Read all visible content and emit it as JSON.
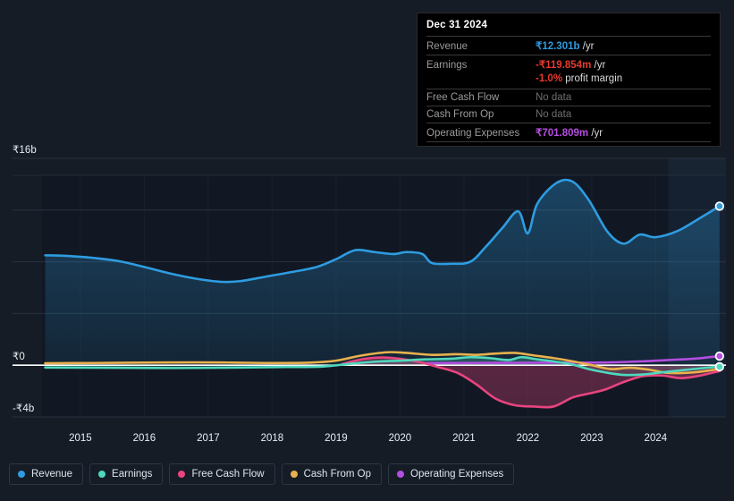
{
  "chart_data": {
    "type": "area",
    "title": "",
    "xlabel": "",
    "ylabel": "",
    "currency": "₹",
    "ylim": [
      -4,
      16
    ],
    "y_ticks": [
      {
        "label": "₹16b",
        "value": 16
      },
      {
        "label": "₹0",
        "value": 0
      },
      {
        "label": "-₹4b",
        "value": -4
      }
    ],
    "gridlines": [
      16,
      12,
      8,
      4,
      0,
      -4
    ],
    "x_ticks": [
      "2015",
      "2016",
      "2017",
      "2018",
      "2019",
      "2020",
      "2021",
      "2022",
      "2023",
      "2024"
    ],
    "xlim": [
      "2014.4",
      "2025.1"
    ],
    "grid": true,
    "legend_position": "bottom",
    "forecast_band_start": "2024.2",
    "series": [
      {
        "name": "Revenue",
        "color": "#2e9ce0",
        "fill": true,
        "end_value": 12.301,
        "points": [
          [
            2014.45,
            8.5
          ],
          [
            2014.8,
            8.45
          ],
          [
            2015.2,
            8.3
          ],
          [
            2015.6,
            8.05
          ],
          [
            2016.0,
            7.6
          ],
          [
            2016.4,
            7.1
          ],
          [
            2016.8,
            6.7
          ],
          [
            2017.2,
            6.45
          ],
          [
            2017.5,
            6.5
          ],
          [
            2017.9,
            6.85
          ],
          [
            2018.3,
            7.2
          ],
          [
            2018.7,
            7.6
          ],
          [
            2019.0,
            8.2
          ],
          [
            2019.3,
            8.9
          ],
          [
            2019.6,
            8.75
          ],
          [
            2019.9,
            8.6
          ],
          [
            2020.1,
            8.75
          ],
          [
            2020.35,
            8.6
          ],
          [
            2020.5,
            7.9
          ],
          [
            2020.8,
            7.85
          ],
          [
            2021.1,
            8.0
          ],
          [
            2021.35,
            9.2
          ],
          [
            2021.6,
            10.6
          ],
          [
            2021.85,
            11.9
          ],
          [
            2022.0,
            10.2
          ],
          [
            2022.15,
            12.5
          ],
          [
            2022.45,
            14.1
          ],
          [
            2022.7,
            14.2
          ],
          [
            2022.95,
            12.8
          ],
          [
            2023.25,
            10.3
          ],
          [
            2023.5,
            9.4
          ],
          [
            2023.75,
            10.1
          ],
          [
            2024.0,
            9.9
          ],
          [
            2024.35,
            10.4
          ],
          [
            2024.7,
            11.4
          ],
          [
            2025.0,
            12.301
          ]
        ]
      },
      {
        "name": "Earnings",
        "color": "#4fd8bd",
        "fill": true,
        "end_value": -0.119854,
        "points": [
          [
            2014.45,
            -0.18
          ],
          [
            2015.5,
            -0.2
          ],
          [
            2016.5,
            -0.22
          ],
          [
            2017.5,
            -0.18
          ],
          [
            2018.2,
            -0.14
          ],
          [
            2018.8,
            -0.1
          ],
          [
            2019.3,
            0.15
          ],
          [
            2019.7,
            0.3
          ],
          [
            2020.0,
            0.35
          ],
          [
            2020.4,
            0.45
          ],
          [
            2020.8,
            0.5
          ],
          [
            2021.1,
            0.62
          ],
          [
            2021.4,
            0.55
          ],
          [
            2021.7,
            0.4
          ],
          [
            2021.9,
            0.62
          ],
          [
            2022.15,
            0.45
          ],
          [
            2022.4,
            0.3
          ],
          [
            2022.7,
            0.05
          ],
          [
            2022.95,
            -0.3
          ],
          [
            2023.2,
            -0.55
          ],
          [
            2023.5,
            -0.75
          ],
          [
            2023.8,
            -0.72
          ],
          [
            2024.1,
            -0.55
          ],
          [
            2024.5,
            -0.35
          ],
          [
            2024.8,
            -0.2
          ],
          [
            2025.0,
            -0.119854
          ]
        ]
      },
      {
        "name": "Free Cash Flow",
        "color": "#e8447f",
        "fill": true,
        "end_value": null,
        "points": [
          [
            2019.1,
            0.1
          ],
          [
            2019.4,
            0.45
          ],
          [
            2019.7,
            0.6
          ],
          [
            2020.0,
            0.5
          ],
          [
            2020.3,
            0.25
          ],
          [
            2020.6,
            -0.15
          ],
          [
            2020.9,
            -0.6
          ],
          [
            2021.2,
            -1.5
          ],
          [
            2021.5,
            -2.6
          ],
          [
            2021.8,
            -3.1
          ],
          [
            2022.1,
            -3.2
          ],
          [
            2022.4,
            -3.2
          ],
          [
            2022.7,
            -2.5
          ],
          [
            2022.95,
            -2.2
          ],
          [
            2023.2,
            -1.9
          ],
          [
            2023.5,
            -1.3
          ],
          [
            2023.8,
            -0.85
          ],
          [
            2024.1,
            -0.8
          ],
          [
            2024.4,
            -1.0
          ],
          [
            2024.7,
            -0.8
          ],
          [
            2025.0,
            -0.45
          ]
        ]
      },
      {
        "name": "Cash From Op",
        "color": "#e8b14c",
        "fill": false,
        "end_value": null,
        "points": [
          [
            2014.45,
            0.15
          ],
          [
            2015.2,
            0.17
          ],
          [
            2016.0,
            0.2
          ],
          [
            2016.8,
            0.22
          ],
          [
            2017.4,
            0.2
          ],
          [
            2018.0,
            0.17
          ],
          [
            2018.6,
            0.2
          ],
          [
            2019.0,
            0.35
          ],
          [
            2019.4,
            0.75
          ],
          [
            2019.8,
            1.0
          ],
          [
            2020.1,
            0.95
          ],
          [
            2020.5,
            0.8
          ],
          [
            2020.9,
            0.85
          ],
          [
            2021.2,
            0.8
          ],
          [
            2021.5,
            0.9
          ],
          [
            2021.8,
            0.95
          ],
          [
            2022.1,
            0.75
          ],
          [
            2022.4,
            0.55
          ],
          [
            2022.7,
            0.3
          ],
          [
            2023.0,
            0.0
          ],
          [
            2023.3,
            -0.3
          ],
          [
            2023.6,
            -0.2
          ],
          [
            2023.9,
            -0.35
          ],
          [
            2024.2,
            -0.6
          ],
          [
            2024.6,
            -0.55
          ],
          [
            2025.0,
            -0.3
          ]
        ]
      },
      {
        "name": "Operating Expenses",
        "color": "#b44ee0",
        "fill": false,
        "end_value": 0.701809,
        "points": [
          [
            2020.4,
            0.16
          ],
          [
            2021.0,
            0.17
          ],
          [
            2021.6,
            0.18
          ],
          [
            2022.2,
            0.19
          ],
          [
            2022.8,
            0.2
          ],
          [
            2023.3,
            0.22
          ],
          [
            2023.8,
            0.3
          ],
          [
            2024.2,
            0.4
          ],
          [
            2024.6,
            0.5
          ],
          [
            2025.0,
            0.701809
          ]
        ]
      }
    ]
  },
  "tooltip": {
    "title": "Dec 31 2024",
    "rows": [
      {
        "label": "Revenue",
        "value": "₹12.301b",
        "unit": "/yr",
        "color": "#2e9ce0",
        "no_data": false
      },
      {
        "label": "Earnings",
        "value": "-₹119.854m",
        "unit": "/yr",
        "color": "#e8392e",
        "no_data": false
      },
      {
        "label": "",
        "value": "-1.0%",
        "unit": "profit margin",
        "color": "#e8392e",
        "sub": true,
        "no_data": false
      },
      {
        "label": "Free Cash Flow",
        "value": "No data",
        "unit": "",
        "color": "#6e6e6e",
        "no_data": true
      },
      {
        "label": "Cash From Op",
        "value": "No data",
        "unit": "",
        "color": "#6e6e6e",
        "no_data": true
      },
      {
        "label": "Operating Expenses",
        "value": "₹701.809m",
        "unit": "/yr",
        "color": "#b44ee0",
        "no_data": false
      }
    ]
  },
  "legend": {
    "items": [
      {
        "label": "Revenue",
        "color": "#2e9ce0"
      },
      {
        "label": "Earnings",
        "color": "#4fd8bd"
      },
      {
        "label": "Free Cash Flow",
        "color": "#e8447f"
      },
      {
        "label": "Cash From Op",
        "color": "#e8b14c"
      },
      {
        "label": "Operating Expenses",
        "color": "#b44ee0"
      }
    ]
  },
  "colors": {
    "background": "#151c26",
    "plot_background": "#111823",
    "gridline": "#2c3644",
    "zero_line": "#ffffff",
    "axis_text": "#e9edf2"
  }
}
